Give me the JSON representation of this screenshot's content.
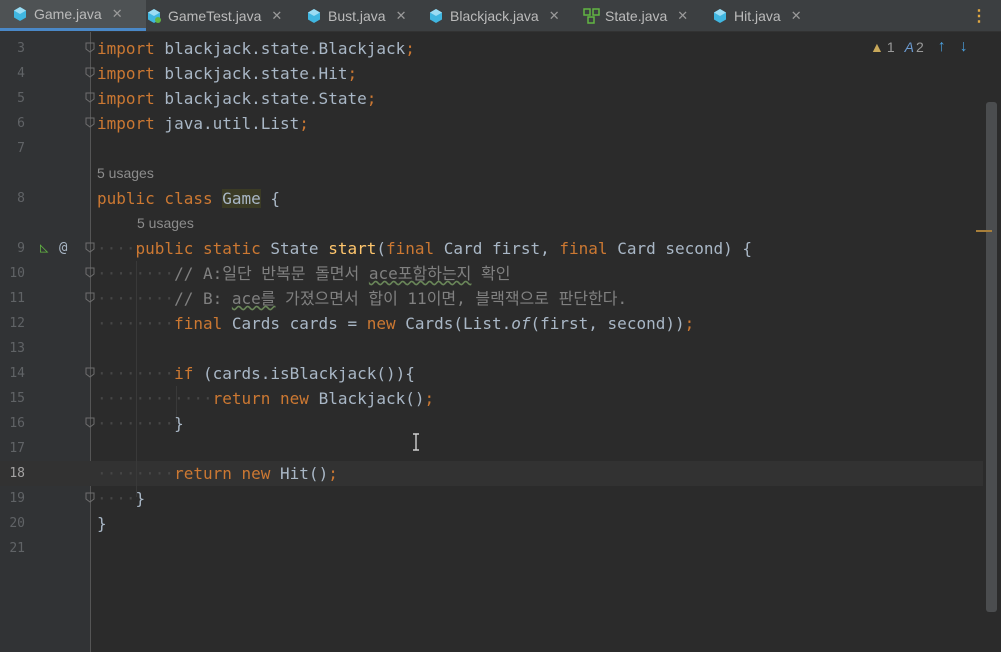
{
  "tabs": [
    {
      "label": "Game.java",
      "active": true,
      "icon": "java-class-icon"
    },
    {
      "label": "GameTest.java",
      "active": false,
      "icon": "java-test-icon"
    },
    {
      "label": "Bust.java",
      "active": false,
      "icon": "java-class-icon"
    },
    {
      "label": "Blackjack.java",
      "active": false,
      "icon": "java-class-icon"
    },
    {
      "label": "State.java",
      "active": false,
      "icon": "java-interface-icon"
    },
    {
      "label": "Hit.java",
      "active": false,
      "icon": "java-class-icon"
    }
  ],
  "inspections": {
    "warnings": "1",
    "typos": "2"
  },
  "usages": {
    "class": "5 usages",
    "method": "5 usages"
  },
  "line_numbers": [
    "3",
    "4",
    "5",
    "6",
    "7",
    "8",
    "9",
    "10",
    "11",
    "12",
    "13",
    "14",
    "15",
    "16",
    "17",
    "18",
    "19",
    "20",
    "21"
  ],
  "code": {
    "l3": {
      "kw": "import",
      "rest": " blackjack.state.Blackjack",
      "end": ";"
    },
    "l4": {
      "kw": "import",
      "rest": " blackjack.state.Hit",
      "end": ";"
    },
    "l5": {
      "kw": "import",
      "rest": " blackjack.state.State",
      "end": ";"
    },
    "l6": {
      "kw": "import",
      "rest": " java.util.List",
      "end": ";"
    },
    "l8": {
      "kw": "public class ",
      "name": "Game",
      "rest": " {"
    },
    "l9": {
      "kw1": "public static ",
      "type": "State ",
      "fn": "start",
      "p1": "(",
      "kw2": "final ",
      "p2": "Card first, ",
      "kw3": "final ",
      "p3": "Card second) {"
    },
    "l10": {
      "pre": "// A:일단 반복문 돌면서 ",
      "wavy": "ace포함하는지",
      "post": " 확인"
    },
    "l11": {
      "pre": "// B: ",
      "wavy": "ace를",
      "post": " 가졌으면서 합이 11이면, 블랙잭으로 판단한다."
    },
    "l12": {
      "kw": "final ",
      "a": "Cards cards = ",
      "kw2": "new ",
      "b": "Cards(List.",
      "it": "of",
      "c": "(first, second))",
      "end": ";"
    },
    "l14": {
      "kw": "if ",
      "rest": "(cards.isBlackjack()){"
    },
    "l15": {
      "kw": "return new ",
      "rest": "Blackjack()",
      "end": ";"
    },
    "l16": {
      "rest": "}"
    },
    "l18": {
      "kw": "return new ",
      "rest": "Hit()",
      "end": ";"
    },
    "l19": {
      "rest": "}"
    },
    "l20": {
      "rest": "}"
    }
  },
  "colors": {
    "keyword": "#cc7832",
    "method": "#ffc66d",
    "comment": "#808080",
    "text": "#a9b7c6",
    "background": "#2b2b2b"
  }
}
